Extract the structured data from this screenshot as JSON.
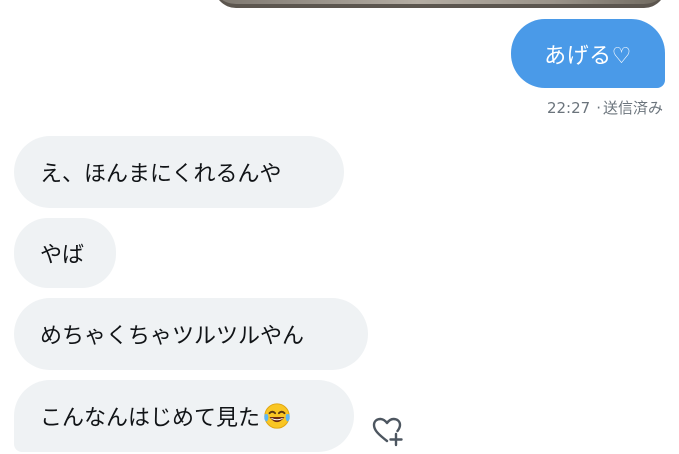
{
  "sent": {
    "message": "あげる♡",
    "time": "22:27",
    "status": "送信済み"
  },
  "received": [
    {
      "text": "え、ほんまにくれるんや"
    },
    {
      "text": "やば"
    },
    {
      "text": "めちゃくちゃツルツルやん"
    },
    {
      "text": "こんなんはじめて見た",
      "emoji": "face-with-tears-of-joy"
    }
  ],
  "reaction_icon": "heart-plus-icon",
  "colors": {
    "sent_bubble": "#4a9ae8",
    "received_bubble": "#eff2f4",
    "meta_text": "#6b747c"
  }
}
